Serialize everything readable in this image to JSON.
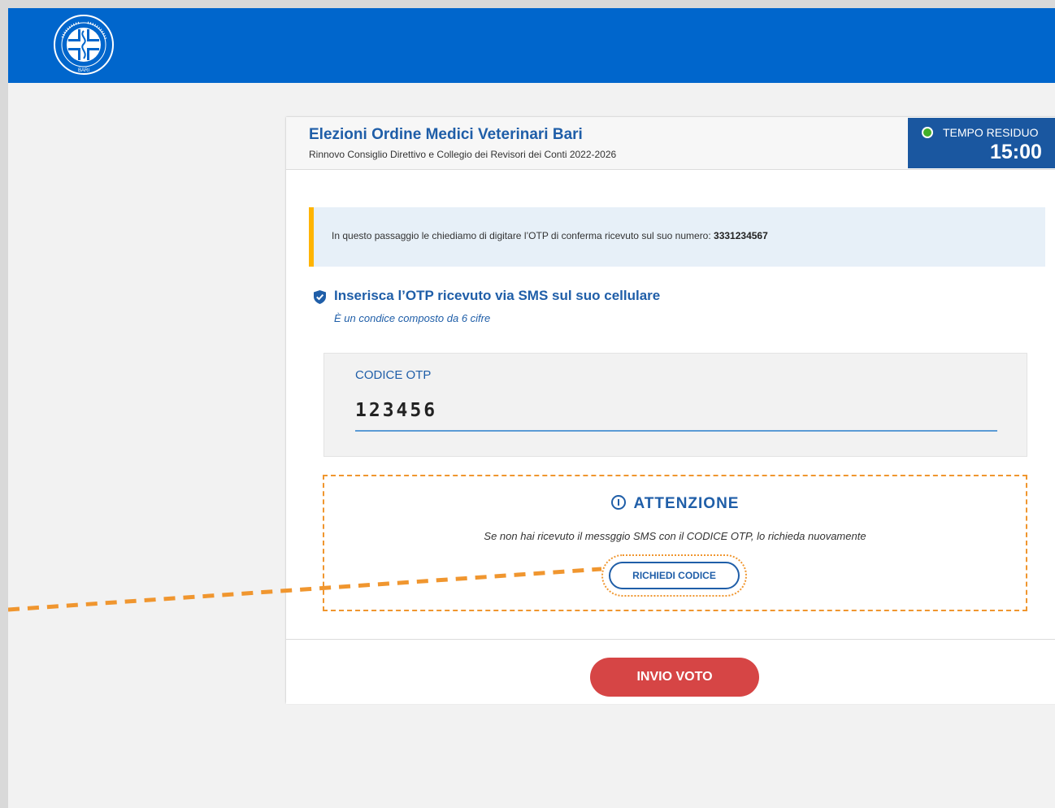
{
  "header": {
    "logo_icon": "ordine-medici-veterinari-bari-seal-icon",
    "logo_caption": "BARI",
    "brand_color": "#0066cc"
  },
  "election": {
    "title": "Elezioni Ordine Medici Veterinari Bari",
    "subtitle": "Rinnovo Consiglio Direttivo e Collegio dei Revisori dei Conti 2022-2026"
  },
  "timer": {
    "label": "TEMPO RESIDUO",
    "value": "15:00",
    "status_color": "#43b02a"
  },
  "info": {
    "text": "In questo passaggio le chiediamo di digitare l’OTP  di conferma ricevuto sul suo numero: ",
    "phone": "3331234567",
    "accent_color": "#ffb400"
  },
  "otp": {
    "icon": "shield-check-icon",
    "title": "Inserisca l’OTP ricevuto via SMS  sul suo cellulare",
    "subtitle": "È un condice composto da 6 cifre",
    "field_label": "CODICE OTP",
    "value": "123456"
  },
  "warning": {
    "icon": "info-circle-icon",
    "title": "ATTENZIONE",
    "text": "Se non hai ricevuto il messggio SMS con il CODICE OTP, lo richieda nuovamente",
    "button_label": "RICHIEDI CODICE",
    "highlight_color": "#f0962f"
  },
  "footer": {
    "submit_label": "INVIO VOTO",
    "submit_color": "#d64545"
  }
}
